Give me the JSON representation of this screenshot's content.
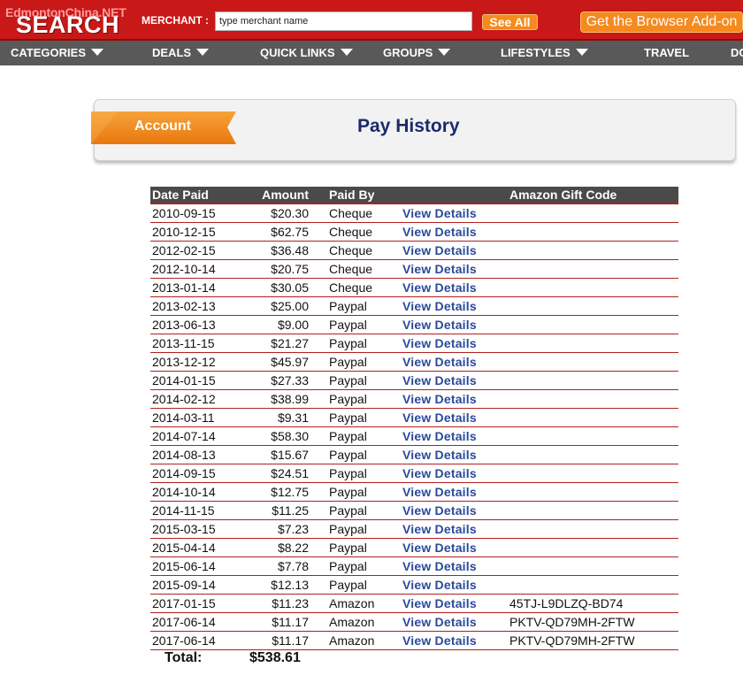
{
  "header": {
    "logo_sub": "EdmontonChina.NET",
    "logo_main": "SEARCH",
    "merchant_label": "MERCHANT :",
    "merchant_placeholder": "type merchant name",
    "see_all": "See All",
    "addon": "Get the Browser Add-on",
    "brand_color": "#c81818",
    "accent_color": "#f58a1f"
  },
  "nav": [
    {
      "label": "CATEGORIES",
      "caret": true
    },
    {
      "label": "DEALS",
      "caret": true
    },
    {
      "label": "QUICK LINKS",
      "caret": true
    },
    {
      "label": "GROUPS",
      "caret": true
    },
    {
      "label": "LIFESTYLES",
      "caret": true
    },
    {
      "label": "TRAVEL",
      "caret": false
    },
    {
      "label": "DC",
      "caret": false
    }
  ],
  "panel": {
    "ribbon_label": "Account",
    "title": "Pay History"
  },
  "table": {
    "headers": [
      "Date Paid",
      "Amount",
      "Paid By",
      "",
      "Amazon Gift Code"
    ],
    "details_label": "View Details",
    "rows": [
      {
        "date": "2010-09-15",
        "amount": "$20.30",
        "paid_by": "Cheque",
        "code": ""
      },
      {
        "date": "2010-12-15",
        "amount": "$62.75",
        "paid_by": "Cheque",
        "code": ""
      },
      {
        "date": "2012-02-15",
        "amount": "$36.48",
        "paid_by": "Cheque",
        "code": ""
      },
      {
        "date": "2012-10-14",
        "amount": "$20.75",
        "paid_by": "Cheque",
        "code": ""
      },
      {
        "date": "2013-01-14",
        "amount": "$30.05",
        "paid_by": "Cheque",
        "code": ""
      },
      {
        "date": "2013-02-13",
        "amount": "$25.00",
        "paid_by": "Paypal",
        "code": ""
      },
      {
        "date": "2013-06-13",
        "amount": "$9.00",
        "paid_by": "Paypal",
        "code": ""
      },
      {
        "date": "2013-11-15",
        "amount": "$21.27",
        "paid_by": "Paypal",
        "code": ""
      },
      {
        "date": "2013-12-12",
        "amount": "$45.97",
        "paid_by": "Paypal",
        "code": ""
      },
      {
        "date": "2014-01-15",
        "amount": "$27.33",
        "paid_by": "Paypal",
        "code": ""
      },
      {
        "date": "2014-02-12",
        "amount": "$38.99",
        "paid_by": "Paypal",
        "code": ""
      },
      {
        "date": "2014-03-11",
        "amount": "$9.31",
        "paid_by": "Paypal",
        "code": ""
      },
      {
        "date": "2014-07-14",
        "amount": "$58.30",
        "paid_by": "Paypal",
        "code": ""
      },
      {
        "date": "2014-08-13",
        "amount": "$15.67",
        "paid_by": "Paypal",
        "code": ""
      },
      {
        "date": "2014-09-15",
        "amount": "$24.51",
        "paid_by": "Paypal",
        "code": ""
      },
      {
        "date": "2014-10-14",
        "amount": "$12.75",
        "paid_by": "Paypal",
        "code": ""
      },
      {
        "date": "2014-11-15",
        "amount": "$11.25",
        "paid_by": "Paypal",
        "code": ""
      },
      {
        "date": "2015-03-15",
        "amount": "$7.23",
        "paid_by": "Paypal",
        "code": ""
      },
      {
        "date": "2015-04-14",
        "amount": "$8.22",
        "paid_by": "Paypal",
        "code": ""
      },
      {
        "date": "2015-06-14",
        "amount": "$7.78",
        "paid_by": "Paypal",
        "code": ""
      },
      {
        "date": "2015-09-14",
        "amount": "$12.13",
        "paid_by": "Paypal",
        "code": ""
      },
      {
        "date": "2017-01-15",
        "amount": "$11.23",
        "paid_by": "Amazon",
        "code": "45TJ-L9DLZQ-BD74"
      },
      {
        "date": "2017-06-14",
        "amount": "$11.17",
        "paid_by": "Amazon",
        "code": "PKTV-QD79MH-2FTW"
      },
      {
        "date": "2017-06-14",
        "amount": "$11.17",
        "paid_by": "Amazon",
        "code": "PKTV-QD79MH-2FTW"
      }
    ],
    "total_label": "Total:",
    "total_value": "$538.61"
  }
}
